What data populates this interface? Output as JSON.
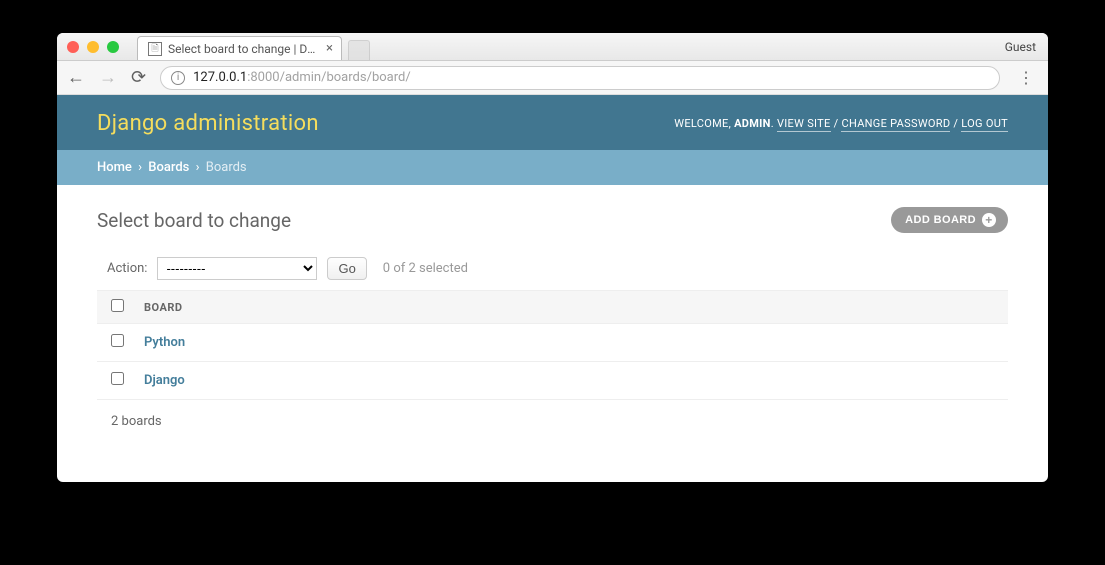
{
  "browser": {
    "tab_title": "Select board to change | Djang",
    "guest_label": "Guest",
    "url_host": "127.0.0.1",
    "url_port_path": ":8000/admin/boards/board/"
  },
  "admin_header": {
    "title": "Django administration",
    "welcome_label": "WELCOME,",
    "username": "ADMIN",
    "view_site": "VIEW SITE",
    "change_password": "CHANGE PASSWORD",
    "log_out": "LOG OUT"
  },
  "breadcrumbs": {
    "home": "Home",
    "app": "Boards",
    "current": "Boards"
  },
  "content": {
    "heading": "Select board to change",
    "add_button": "ADD BOARD",
    "action_label": "Action:",
    "action_placeholder": "---------",
    "go_label": "Go",
    "selection_counter": "0 of 2 selected",
    "column_header": "BOARD",
    "rows": [
      {
        "name": "Python"
      },
      {
        "name": "Django"
      }
    ],
    "paginator": "2 boards"
  }
}
